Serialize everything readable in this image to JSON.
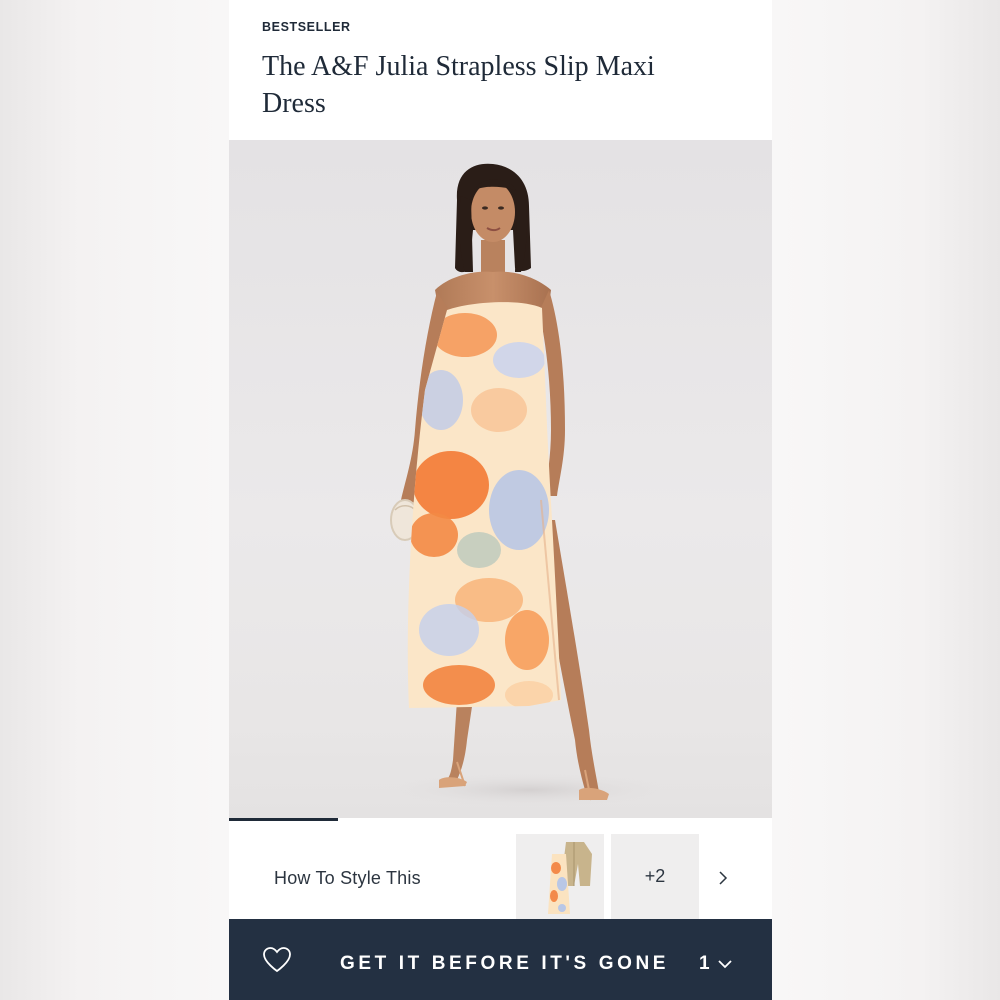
{
  "product": {
    "badge": "BESTSELLER",
    "title": "The A&F Julia Strapless Slip Maxi Dress"
  },
  "gallery": {
    "image_alt": "Model wearing strapless tie-dye slip maxi dress",
    "image_index_fraction": 0.2
  },
  "style_section": {
    "label": "How To Style This",
    "more_count": "+2"
  },
  "cta": {
    "label": "GET IT BEFORE IT'S GONE",
    "quantity": "1"
  },
  "icons": {
    "wishlist": "heart-icon",
    "next": "chevron-right-icon",
    "quantity_dropdown": "chevron-down-icon"
  },
  "colors": {
    "navy": "#233042",
    "text": "#1f2a38",
    "dress_orange": "#f38a4a",
    "dress_blue": "#b9c7e6",
    "dress_cream": "#fbe3c0"
  }
}
